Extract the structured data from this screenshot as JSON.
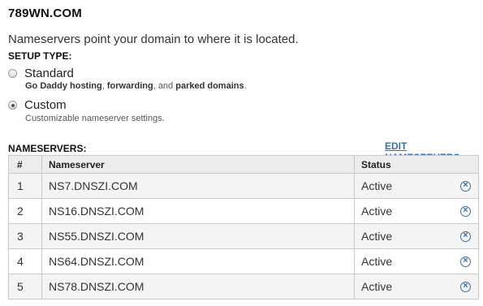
{
  "domain": "789WN.COM",
  "intro": "Nameservers point your domain to where it is located.",
  "setup_label": "SETUP TYPE:",
  "options": [
    {
      "label": "Standard",
      "desc_parts": [
        "Go Daddy hosting",
        ", ",
        "forwarding",
        ", and ",
        "parked domains",
        "."
      ],
      "checked": false
    },
    {
      "label": "Custom",
      "desc": "Customizable nameserver settings.",
      "checked": true
    }
  ],
  "nameservers_heading": "NAMESERVERS:",
  "edit_link": "EDIT NAMESERVERS",
  "table": {
    "headers": [
      "#",
      "Nameserver",
      "Status"
    ],
    "rows": [
      {
        "num": "1",
        "name": "NS7.DNSZI.COM",
        "status": "Active"
      },
      {
        "num": "2",
        "name": "NS16.DNSZI.COM",
        "status": "Active"
      },
      {
        "num": "3",
        "name": "NS55.DNSZI.COM",
        "status": "Active"
      },
      {
        "num": "4",
        "name": "NS64.DNSZI.COM",
        "status": "Active"
      },
      {
        "num": "5",
        "name": "NS78.DNSZI.COM",
        "status": "Active"
      }
    ]
  },
  "icons": {
    "remove": "close-circle-icon",
    "radio": "radio-icon"
  },
  "colors": {
    "link": "#3d6ea3",
    "header_bg": "#ececec",
    "stripe": "#f4f4f4"
  }
}
